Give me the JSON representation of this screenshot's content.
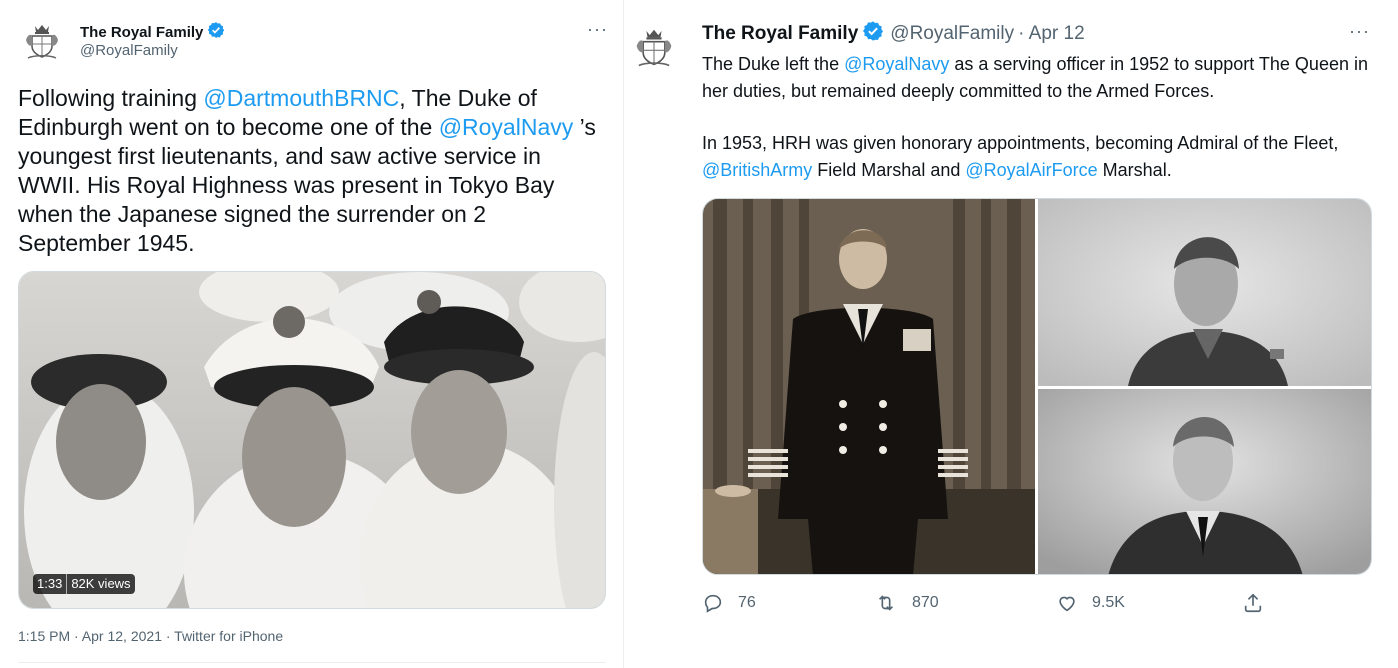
{
  "left_tweet": {
    "author_name": "The Royal Family",
    "author_handle": "@RoyalFamily",
    "text_parts": [
      "Following training ",
      "@DartmouthBRNC",
      ", The Duke of Edinburgh went on to become one of the ",
      "@RoyalNavy",
      " ’s youngest first lieutenants, and saw active service in WWII. His Royal Highness was present in Tokyo Bay when the Japanese signed the surrender on 2 September 1945."
    ],
    "video": {
      "duration": "1:33",
      "views": "82K views"
    },
    "timestamp": "1:15 PM · Apr 12, 2021 · Twitter for iPhone",
    "more_label": "···"
  },
  "right_tweet": {
    "author_name": "The Royal Family",
    "author_handle": "@RoyalFamily",
    "date": "· Apr 12",
    "more_label": "···",
    "para1_parts": [
      "The Duke left the ",
      "@RoyalNavy",
      " as a serving officer in 1952 to support The Queen in her duties, but remained deeply committed to the Armed Forces."
    ],
    "para2_parts": [
      "In 1953, HRH was given honorary appointments, becoming Admiral of the Fleet, ",
      "@BritishArmy",
      " Field Marshal and ",
      "@RoyalAirForce",
      " Marshal."
    ],
    "actions": {
      "reply": {
        "icon": "reply-icon",
        "count": "76"
      },
      "retweet": {
        "icon": "retweet-icon",
        "count": "870"
      },
      "like": {
        "icon": "heart-icon",
        "count": "9.5K"
      },
      "share": {
        "icon": "share-icon"
      }
    }
  },
  "colors": {
    "link": "#1d9bf0",
    "secondary_text": "#536471",
    "verified": "#1d9bf0"
  }
}
